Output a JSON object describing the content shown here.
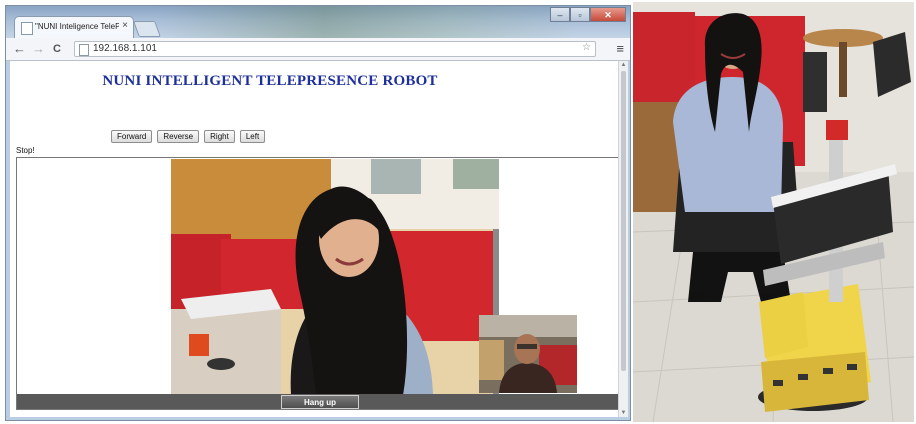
{
  "browser": {
    "tab_title": "\"NUNI Inteligence TelePr",
    "tab_close": "×",
    "url": "192.168.1.101",
    "window_buttons": {
      "minimize": "–",
      "maximize": "▫",
      "close": "✕"
    }
  },
  "page": {
    "title": "NUNI INTELLIGENT TELEPRESENCE ROBOT",
    "buttons": {
      "forward": "Forward",
      "reverse": "Reverse",
      "right": "Right",
      "left": "Left"
    },
    "status": "Stop!",
    "hang_up": "Hang up"
  },
  "icons": {
    "back": "←",
    "forward": "→",
    "reload": "C",
    "menu": "≡",
    "star": "☆"
  }
}
